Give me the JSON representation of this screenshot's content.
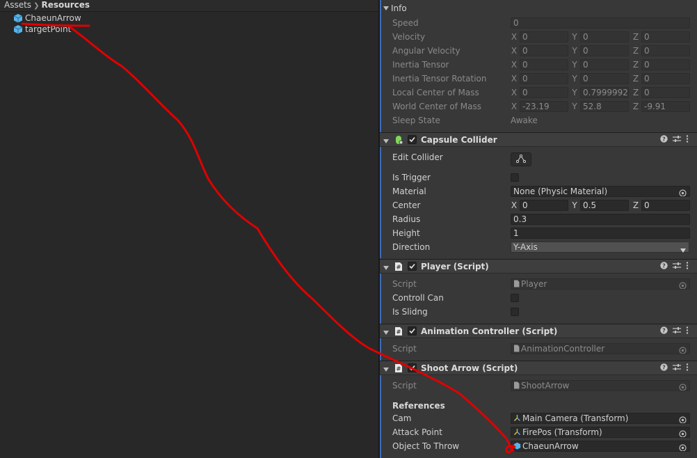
{
  "project": {
    "breadcrumb": [
      "Assets",
      "Resources"
    ],
    "assets": [
      "ChaeunArrow",
      "targetPoint"
    ]
  },
  "rigidbody_info": {
    "header": "Info",
    "speed_label": "Speed",
    "speed": "0",
    "velocity_label": "Velocity",
    "velocity": [
      "0",
      "0",
      "0"
    ],
    "angular_velocity_label": "Angular Velocity",
    "angular_velocity": [
      "0",
      "0",
      "0"
    ],
    "inertia_tensor_label": "Inertia Tensor",
    "inertia_tensor": [
      "0",
      "0",
      "0"
    ],
    "inertia_tensor_rotation_label": "Inertia Tensor Rotation",
    "inertia_tensor_rotation": [
      "0",
      "0",
      "0"
    ],
    "local_com_label": "Local Center of Mass",
    "local_com": [
      "0",
      "0.7999992",
      "0"
    ],
    "world_com_label": "World Center of Mass",
    "world_com": [
      "-23.19",
      "52.8",
      "-9.91"
    ],
    "sleep_state_label": "Sleep State",
    "sleep_state": "Awake"
  },
  "axes": [
    "X",
    "Y",
    "Z"
  ],
  "capsule_collider": {
    "title": "Capsule Collider",
    "edit_collider_label": "Edit Collider",
    "is_trigger_label": "Is Trigger",
    "is_trigger": false,
    "material_label": "Material",
    "material": "None (Physic Material)",
    "center_label": "Center",
    "center": [
      "0",
      "0.5",
      "0"
    ],
    "radius_label": "Radius",
    "radius": "0.3",
    "height_label": "Height",
    "height": "1",
    "direction_label": "Direction",
    "direction": "Y-Axis"
  },
  "player_script": {
    "title": "Player (Script)",
    "script_label": "Script",
    "script": "Player",
    "controll_can_label": "Controll Can",
    "controll_can": false,
    "is_slidng_label": "Is Slidng",
    "is_slidng": false
  },
  "animation_controller": {
    "title": "Animation Controller (Script)",
    "script_label": "Script",
    "script": "AnimationController"
  },
  "shoot_arrow": {
    "title": "Shoot Arrow (Script)",
    "script_label": "Script",
    "script": "ShootArrow",
    "references_label": "References",
    "cam_label": "Cam",
    "cam": "Main Camera (Transform)",
    "attack_point_label": "Attack Point",
    "attack_point": "FirePos (Transform)",
    "object_to_throw_label": "Object To Throw",
    "object_to_throw": "ChaeunArrow"
  },
  "colors": {
    "annotation": "#e00000",
    "cube_icon": "#56b4e9",
    "highlight_bar": "#3e6bb6"
  },
  "icons": {
    "asset": "prefab-cube-icon",
    "help": "help-icon",
    "preset": "preset-sliders-icon",
    "menu": "kebab-menu-icon",
    "picker": "object-picker-icon",
    "edit": "edit-collider-icon",
    "fold": "fold-triangle-icon"
  }
}
